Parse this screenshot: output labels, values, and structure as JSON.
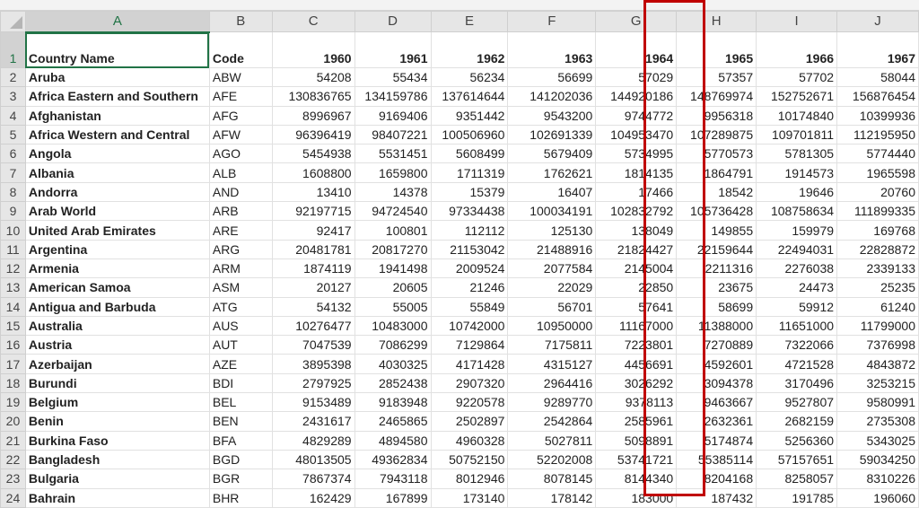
{
  "columns": [
    "A",
    "B",
    "C",
    "D",
    "E",
    "F",
    "G",
    "H",
    "I",
    "J"
  ],
  "header_row": [
    "Country Name",
    "Code",
    "1960",
    "1961",
    "1962",
    "1963",
    "1964",
    "1965",
    "1966",
    "1967"
  ],
  "rows": [
    [
      "Aruba",
      "ABW",
      "54208",
      "55434",
      "56234",
      "56699",
      "57029",
      "57357",
      "57702",
      "58044"
    ],
    [
      "Africa Eastern and Southern",
      "AFE",
      "130836765",
      "134159786",
      "137614644",
      "141202036",
      "144920186",
      "148769974",
      "152752671",
      "156876454"
    ],
    [
      "Afghanistan",
      "AFG",
      "8996967",
      "9169406",
      "9351442",
      "9543200",
      "9744772",
      "9956318",
      "10174840",
      "10399936"
    ],
    [
      "Africa Western and Central",
      "AFW",
      "96396419",
      "98407221",
      "100506960",
      "102691339",
      "104953470",
      "107289875",
      "109701811",
      "112195950"
    ],
    [
      "Angola",
      "AGO",
      "5454938",
      "5531451",
      "5608499",
      "5679409",
      "5734995",
      "5770573",
      "5781305",
      "5774440"
    ],
    [
      "Albania",
      "ALB",
      "1608800",
      "1659800",
      "1711319",
      "1762621",
      "1814135",
      "1864791",
      "1914573",
      "1965598"
    ],
    [
      "Andorra",
      "AND",
      "13410",
      "14378",
      "15379",
      "16407",
      "17466",
      "18542",
      "19646",
      "20760"
    ],
    [
      "Arab World",
      "ARB",
      "92197715",
      "94724540",
      "97334438",
      "100034191",
      "102832792",
      "105736428",
      "108758634",
      "111899335"
    ],
    [
      "United Arab Emirates",
      "ARE",
      "92417",
      "100801",
      "112112",
      "125130",
      "138049",
      "149855",
      "159979",
      "169768"
    ],
    [
      "Argentina",
      "ARG",
      "20481781",
      "20817270",
      "21153042",
      "21488916",
      "21824427",
      "22159644",
      "22494031",
      "22828872"
    ],
    [
      "Armenia",
      "ARM",
      "1874119",
      "1941498",
      "2009524",
      "2077584",
      "2145004",
      "2211316",
      "2276038",
      "2339133"
    ],
    [
      "American Samoa",
      "ASM",
      "20127",
      "20605",
      "21246",
      "22029",
      "22850",
      "23675",
      "24473",
      "25235"
    ],
    [
      "Antigua and Barbuda",
      "ATG",
      "54132",
      "55005",
      "55849",
      "56701",
      "57641",
      "58699",
      "59912",
      "61240"
    ],
    [
      "Australia",
      "AUS",
      "10276477",
      "10483000",
      "10742000",
      "10950000",
      "11167000",
      "11388000",
      "11651000",
      "11799000"
    ],
    [
      "Austria",
      "AUT",
      "7047539",
      "7086299",
      "7129864",
      "7175811",
      "7223801",
      "7270889",
      "7322066",
      "7376998"
    ],
    [
      "Azerbaijan",
      "AZE",
      "3895398",
      "4030325",
      "4171428",
      "4315127",
      "4456691",
      "4592601",
      "4721528",
      "4843872"
    ],
    [
      "Burundi",
      "BDI",
      "2797925",
      "2852438",
      "2907320",
      "2964416",
      "3026292",
      "3094378",
      "3170496",
      "3253215"
    ],
    [
      "Belgium",
      "BEL",
      "9153489",
      "9183948",
      "9220578",
      "9289770",
      "9378113",
      "9463667",
      "9527807",
      "9580991"
    ],
    [
      "Benin",
      "BEN",
      "2431617",
      "2465865",
      "2502897",
      "2542864",
      "2585961",
      "2632361",
      "2682159",
      "2735308"
    ],
    [
      "Burkina Faso",
      "BFA",
      "4829289",
      "4894580",
      "4960328",
      "5027811",
      "5098891",
      "5174874",
      "5256360",
      "5343025"
    ],
    [
      "Bangladesh",
      "BGD",
      "48013505",
      "49362834",
      "50752150",
      "52202008",
      "53741721",
      "55385114",
      "57157651",
      "59034250"
    ],
    [
      "Bulgaria",
      "BGR",
      "7867374",
      "7943118",
      "8012946",
      "8078145",
      "8144340",
      "8204168",
      "8258057",
      "8310226"
    ],
    [
      "Bahrain",
      "BHR",
      "162429",
      "167899",
      "173140",
      "178142",
      "183000",
      "187432",
      "191785",
      "196060"
    ]
  ],
  "highlight_color": "#c00000",
  "selection_color": "#217346"
}
